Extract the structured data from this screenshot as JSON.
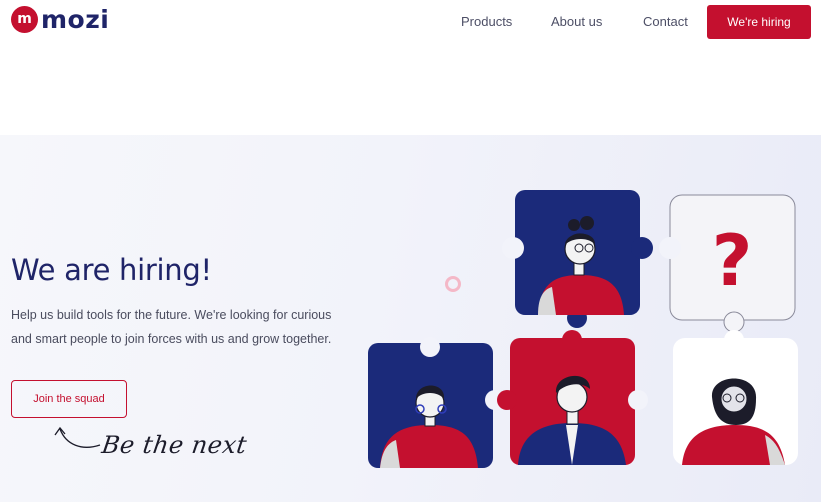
{
  "brand": {
    "logo_letter": "m",
    "name": "mozi"
  },
  "nav": {
    "items": [
      {
        "label": "Products"
      },
      {
        "label": "About us"
      },
      {
        "label": "Contact"
      }
    ],
    "cta_label": "We're hiring"
  },
  "hero": {
    "title": "We are hiring!",
    "subtitle": "Help us build tools for the future. We're looking for curious and smart people to join forces with us and grow together.",
    "cta_label": "Join the squad",
    "handwritten": "Be the next"
  },
  "puzzle": {
    "question_mark": "?"
  },
  "colors": {
    "brand_red": "#c4102f",
    "navy": "#1f2468",
    "light_bg": "#f2f3fa"
  }
}
